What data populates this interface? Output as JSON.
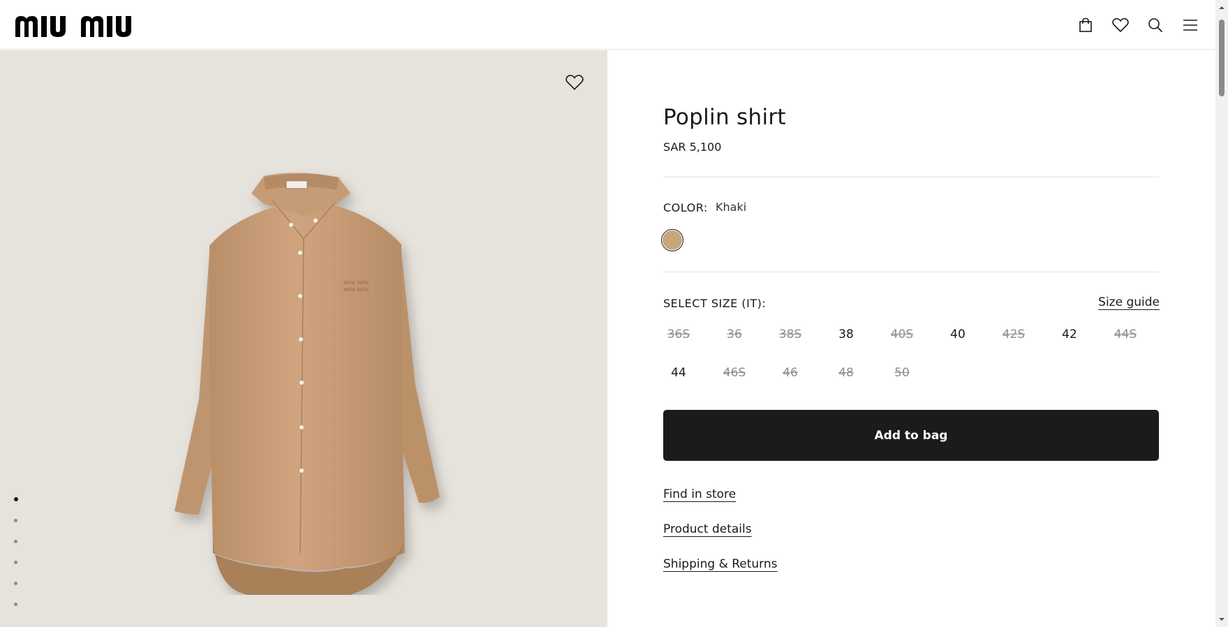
{
  "header": {
    "logo_text": "miu miu",
    "icons": [
      "shopping-bag-icon",
      "heart-icon",
      "search-icon",
      "hamburger-menu-icon"
    ]
  },
  "gallery": {
    "image_alt": "Khaki poplin shirt",
    "dots_count": 6,
    "active_dot": 1
  },
  "product": {
    "title": "Poplin shirt",
    "price": "SAR 5,100",
    "color_label": "COLOR:",
    "color_value": "Khaki",
    "swatch_color": "#c9a57d",
    "size_label": "SELECT SIZE (IT):",
    "size_guide": "Size guide",
    "sizes": [
      {
        "label": "36S",
        "available": false
      },
      {
        "label": "36",
        "available": false
      },
      {
        "label": "38S",
        "available": false
      },
      {
        "label": "38",
        "available": true
      },
      {
        "label": "40S",
        "available": false
      },
      {
        "label": "40",
        "available": true
      },
      {
        "label": "42S",
        "available": false
      },
      {
        "label": "42",
        "available": true
      },
      {
        "label": "44S",
        "available": false
      },
      {
        "label": "44",
        "available": true
      },
      {
        "label": "46S",
        "available": false
      },
      {
        "label": "46",
        "available": false
      },
      {
        "label": "48",
        "available": false
      },
      {
        "label": "50",
        "available": false
      }
    ],
    "add_to_bag": "Add to bag",
    "find_in_store": "Find in store",
    "product_details": "Product details",
    "shipping_returns": "Shipping & Returns"
  },
  "colors": {
    "button_bg": "#1b1b1b",
    "gallery_bg": "#e6e2dc",
    "shirt": "#c9a07a"
  }
}
